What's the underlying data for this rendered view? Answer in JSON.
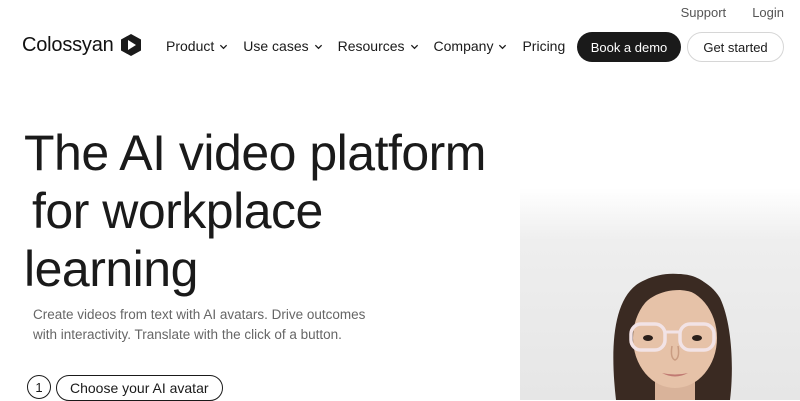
{
  "utility_nav": {
    "support": "Support",
    "login": "Login"
  },
  "logo": {
    "text": "Colossyan"
  },
  "nav": [
    {
      "label": "Product",
      "has_dropdown": true
    },
    {
      "label": "Use cases",
      "has_dropdown": true
    },
    {
      "label": "Resources",
      "has_dropdown": true
    },
    {
      "label": "Company",
      "has_dropdown": true
    },
    {
      "label": "Pricing",
      "has_dropdown": false
    }
  ],
  "buttons": {
    "book_demo": "Book a demo",
    "get_started": "Get started"
  },
  "hero": {
    "title_lines": [
      "The AI video platform",
      "for workplace",
      "learning"
    ],
    "subtitle": "Create videos from text with AI avatars. Drive outcomes with interactivity. Translate with the click of a button.",
    "step_number": "1",
    "step_label": "Choose your AI avatar"
  },
  "colors": {
    "primary_dark": "#1a1a1a",
    "text_muted": "#666666",
    "background": "#ffffff"
  },
  "icons": {
    "logo_mark": "play-hexagon-icon",
    "dropdown": "chevron-down-icon"
  }
}
